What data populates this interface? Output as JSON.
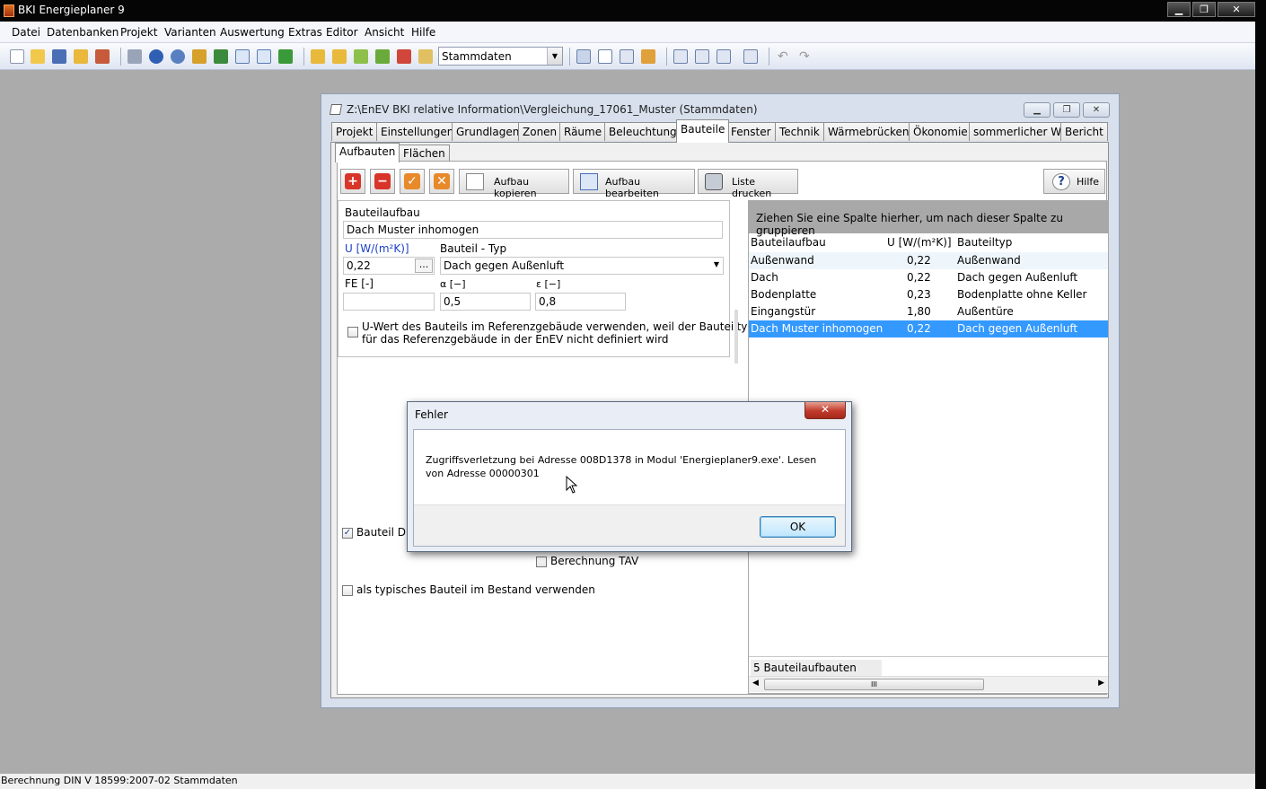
{
  "app": {
    "title": "BKI Energieplaner 9",
    "window_buttons": {
      "minimize": "▁",
      "restore": "❐",
      "close": "✕"
    }
  },
  "menu": {
    "items": [
      "Datei",
      "Datenbanken",
      "Projekt",
      "Varianten",
      "Auswertung",
      "Extras",
      "Editor",
      "Ansicht",
      "Hilfe"
    ]
  },
  "toolbar": {
    "combo_value": "Stammdaten"
  },
  "child_window": {
    "title": "Z:\\EnEV BKI relative Information\\Vergleichung_17061_Muster (Stammdaten)",
    "tabs": [
      "Projekt",
      "Einstellungen",
      "Grundlagen",
      "Zonen",
      "Räume",
      "Beleuchtung",
      "Bauteile",
      "Fenster",
      "Technik",
      "Wärmebrücken",
      "Ökonomie",
      "sommerlicher WS",
      "Bericht"
    ],
    "active_tab": "Bauteile",
    "subtabs": [
      "Aufbauten",
      "Flächen"
    ],
    "buttons": {
      "copy": "Aufbau kopieren",
      "edit": "Aufbau bearbeiten",
      "print": "Liste drucken",
      "help": "Hilfe"
    }
  },
  "form": {
    "bauteilaufbau_label": "Bauteilaufbau",
    "bauteilaufbau_value": "Dach Muster inhomogen",
    "u_label": "U [W/(m²K)]",
    "u_value": "0,22",
    "u_btn": "...",
    "typ_label": "Bauteil - Typ",
    "typ_value": "Dach gegen Außenluft",
    "fe_label": "FE [-]",
    "fe_value": "",
    "alpha_label": "α [−]",
    "alpha_value": "0,5",
    "eps_label": "ε [−]",
    "eps_value": "0,8",
    "ref_checkbox_text_1": "U-Wert des Bauteils im Referenzgebäude verwenden, weil der Bauteiltyp",
    "ref_checkbox_text_2": "für das Referenzgebäude in der EnEV nicht definiert wird",
    "druck_label": "Bauteil Dru",
    "tav_label": "Berechnung TAV",
    "typisch_label": "als typisches Bauteil im Bestand verwenden"
  },
  "grid": {
    "group_hint": "Ziehen Sie eine Spalte hierher, um nach dieser Spalte zu gruppieren",
    "columns": [
      "Bauteilaufbau",
      "U [W/(m²K)]",
      "Bauteiltyp"
    ],
    "rows": [
      {
        "name": "Außenwand",
        "u": "0,22",
        "typ": "Außenwand"
      },
      {
        "name": "Dach",
        "u": "0,22",
        "typ": "Dach gegen Außenluft"
      },
      {
        "name": "Bodenplatte",
        "u": "0,23",
        "typ": "Bodenplatte ohne Keller"
      },
      {
        "name": "Eingangstür",
        "u": "1,80",
        "typ": "Außentüre"
      },
      {
        "name": "Dach Muster inhomogen",
        "u": "0,22",
        "typ": "Dach gegen Außenluft"
      }
    ],
    "selected_index": 4,
    "footer": "5 Bauteilaufbauten",
    "scroll_grip": "III"
  },
  "dialog": {
    "title": "Fehler",
    "message": "Zugriffsverletzung bei Adresse 008D1378 in Modul 'Energieplaner9.exe'. Lesen von Adresse 00000301",
    "ok": "OK",
    "close": "✕"
  },
  "status": {
    "text": "Berechnung DIN V 18599:2007-02 Stammdaten"
  },
  "colors": {
    "selection": "#3399ff",
    "desktop": "#ababab",
    "dialog_close": "#c0392b"
  }
}
